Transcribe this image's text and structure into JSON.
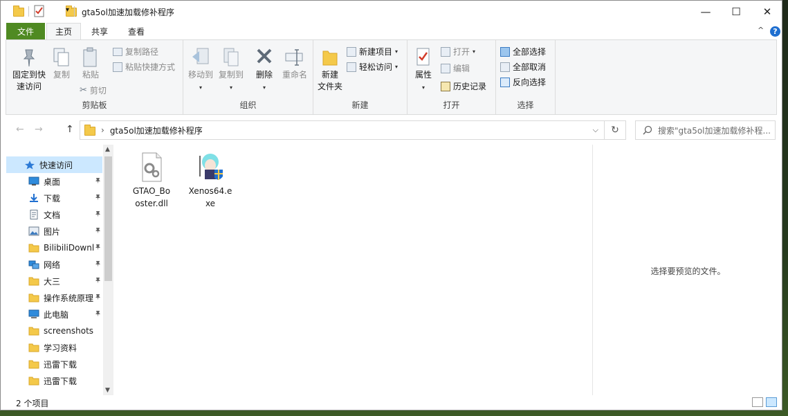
{
  "window": {
    "title": "gta5ol加速加载修补程序",
    "min_glyph": "—",
    "max_glyph": "☐",
    "close_glyph": "✕"
  },
  "ribbon_tabs": {
    "file": "文件",
    "home": "主页",
    "share": "共享",
    "view": "查看",
    "expand_glyph": "^",
    "help_glyph": "?"
  },
  "ribbon": {
    "clipboard": {
      "label": "剪贴板",
      "pin_quick_line1": "固定到快",
      "pin_quick_line2": "速访问",
      "copy": "复制",
      "paste": "粘贴",
      "copy_path": "复制路径",
      "paste_shortcut": "粘贴快捷方式",
      "cut": "剪切"
    },
    "organize": {
      "label": "组织",
      "move_to": "移动到",
      "copy_to": "复制到",
      "delete": "删除",
      "rename": "重命名"
    },
    "new": {
      "label": "新建",
      "new_folder_line1": "新建",
      "new_folder_line2": "文件夹",
      "new_item": "新建项目",
      "easy_access": "轻松访问"
    },
    "open": {
      "label": "打开",
      "properties": "属性",
      "open": "打开",
      "edit": "编辑",
      "history": "历史记录"
    },
    "select": {
      "label": "选择",
      "select_all": "全部选择",
      "select_none": "全部取消",
      "invert": "反向选择"
    }
  },
  "address": {
    "back": "←",
    "forward": "→",
    "up": "↑",
    "path_sep": "›",
    "path": "gta5ol加速加载修补程序",
    "dropdown": "⌵",
    "refresh": "↻",
    "search_placeholder": "搜索\"gta5ol加速加载修补程..."
  },
  "nav": {
    "items": [
      {
        "label": "快速访问",
        "icon": "star-icon"
      },
      {
        "label": "桌面",
        "icon": "desktop-icon",
        "pinned": true
      },
      {
        "label": "下载",
        "icon": "download-icon",
        "pinned": true
      },
      {
        "label": "文档",
        "icon": "document-icon",
        "pinned": true
      },
      {
        "label": "图片",
        "icon": "pictures-icon",
        "pinned": true
      },
      {
        "label": "BilibiliDownl",
        "icon": "folder-icon",
        "pinned": true
      },
      {
        "label": "网络",
        "icon": "network-icon",
        "pinned": true
      },
      {
        "label": "大三",
        "icon": "folder-icon",
        "pinned": true
      },
      {
        "label": "操作系统原理",
        "icon": "folder-icon",
        "pinned": true
      },
      {
        "label": "此电脑",
        "icon": "computer-icon",
        "pinned": true
      },
      {
        "label": "screenshots",
        "icon": "folder-icon"
      },
      {
        "label": "学习资料",
        "icon": "folder-icon"
      },
      {
        "label": "迅雷下载",
        "icon": "folder-icon"
      },
      {
        "label": "迅雷下载",
        "icon": "folder-icon"
      }
    ],
    "pin_glyph": "📌"
  },
  "files": [
    {
      "line1": "GTAO_Bo",
      "line2": "oster.dll",
      "icon": "dll-file-icon"
    },
    {
      "line1": "Xenos64.e",
      "line2": "xe",
      "icon": "xenos-app-icon"
    }
  ],
  "preview": {
    "empty_text": "选择要预览的文件。"
  },
  "status": {
    "count": "2 个项目"
  }
}
